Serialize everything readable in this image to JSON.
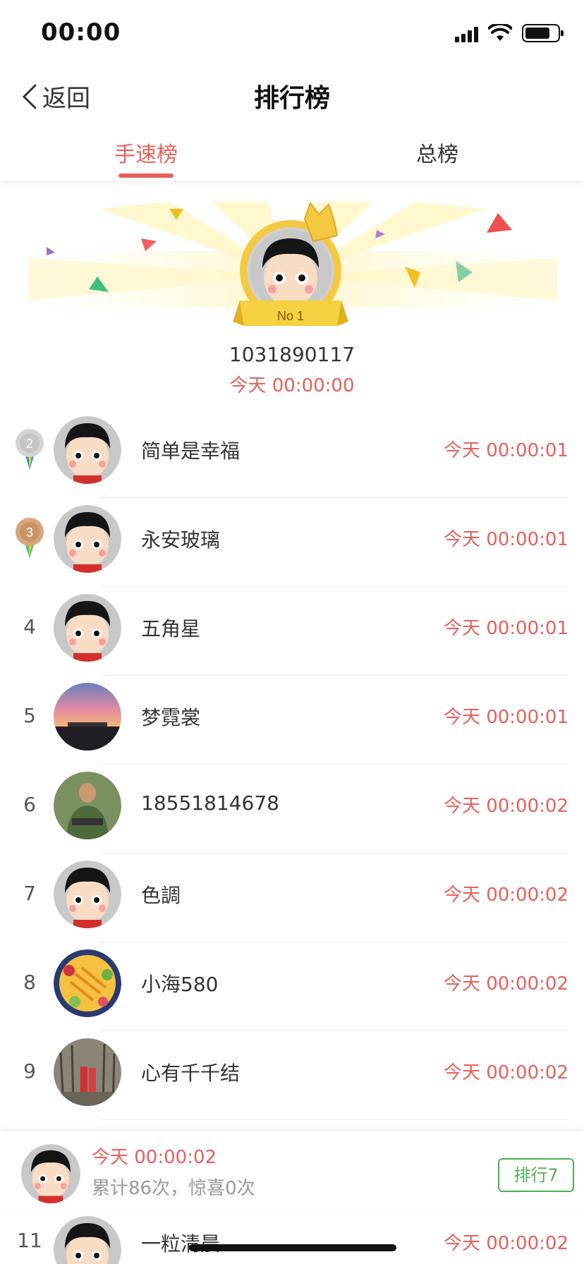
{
  "status_bar": {
    "time": "00:00"
  },
  "nav": {
    "back_label": "返回",
    "title": "排行榜"
  },
  "tabs": [
    {
      "label": "手速榜",
      "active": true
    },
    {
      "label": "总榜",
      "active": false
    }
  ],
  "winner": {
    "badge": "No 1",
    "user_id": "1031890117",
    "time": "今天 00:00:00"
  },
  "rows": [
    {
      "rank": "2",
      "medal": "silver",
      "name": "简单是幸福",
      "time": "今天 00:00:01",
      "avatar": "cartoon"
    },
    {
      "rank": "3",
      "medal": "bronze",
      "name": "永安玻璃",
      "time": "今天 00:00:01",
      "avatar": "cartoon"
    },
    {
      "rank": "4",
      "medal": "",
      "name": "五角星",
      "time": "今天 00:00:01",
      "avatar": "cartoon"
    },
    {
      "rank": "5",
      "medal": "",
      "name": "梦霓裳",
      "time": "今天 00:00:01",
      "avatar": "sunset"
    },
    {
      "rank": "6",
      "medal": "",
      "name": "18551814678",
      "time": "今天 00:00:02",
      "avatar": "soldier"
    },
    {
      "rank": "7",
      "medal": "",
      "name": "色調",
      "time": "今天 00:00:02",
      "avatar": "cartoon"
    },
    {
      "rank": "8",
      "medal": "",
      "name": "小海580",
      "time": "今天 00:00:02",
      "avatar": "fruit"
    },
    {
      "rank": "9",
      "medal": "",
      "name": "心有千千结",
      "time": "今天 00:00:02",
      "avatar": "forest"
    }
  ],
  "self_card": {
    "time": "今天 00:00:02",
    "stats": "累计86次，惊喜0次",
    "rank_button": "排行7"
  },
  "peek_row": {
    "rank": "11",
    "name": "一粒清晨",
    "time": "今天 00:00:02"
  },
  "colors": {
    "accent": "#e8605a",
    "green": "#4caf50",
    "gold": "#f5c842"
  }
}
